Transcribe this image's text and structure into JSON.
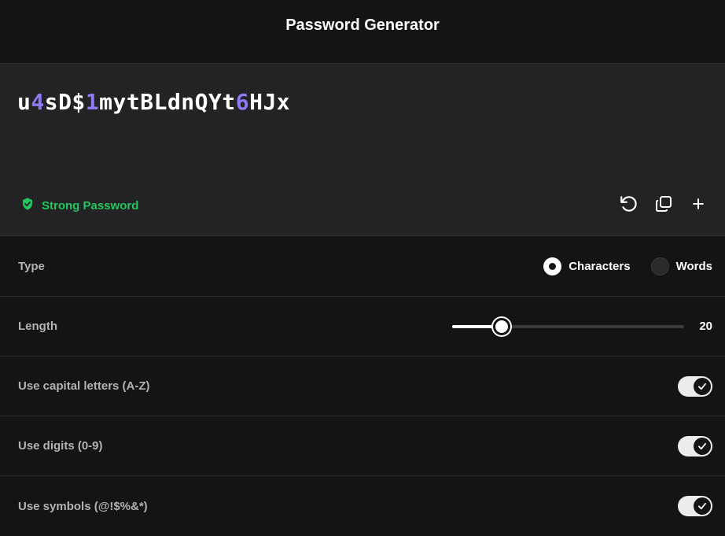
{
  "header": {
    "title": "Password Generator"
  },
  "password": {
    "segments": [
      {
        "text": "u",
        "digit": false
      },
      {
        "text": "4",
        "digit": true
      },
      {
        "text": "sD$",
        "digit": false
      },
      {
        "text": "1",
        "digit": true
      },
      {
        "text": "mytBLdnQYt",
        "digit": false
      },
      {
        "text": "6",
        "digit": true
      },
      {
        "text": "HJx",
        "digit": false
      }
    ]
  },
  "strength": {
    "label": "Strong Password",
    "color": "#22c55e",
    "icon": "shield-check-icon"
  },
  "actions": [
    {
      "name": "regenerate",
      "icon": "refresh-icon"
    },
    {
      "name": "copy",
      "icon": "copy-icon"
    },
    {
      "name": "add",
      "icon": "plus-icon"
    }
  ],
  "settings": {
    "type": {
      "label": "Type",
      "options": [
        {
          "label": "Characters",
          "selected": true
        },
        {
          "label": "Words",
          "selected": false
        }
      ]
    },
    "length": {
      "label": "Length",
      "value": "20",
      "fraction": 0.215
    },
    "capitals": {
      "label": "Use capital letters (A-Z)",
      "enabled": true
    },
    "digits": {
      "label": "Use digits (0-9)",
      "enabled": true
    },
    "symbols": {
      "label": "Use symbols (@!$%&*)",
      "enabled": true
    }
  },
  "colors": {
    "accent_digit": "#8b7bf5",
    "background": "#141414",
    "panel": "#232325"
  }
}
